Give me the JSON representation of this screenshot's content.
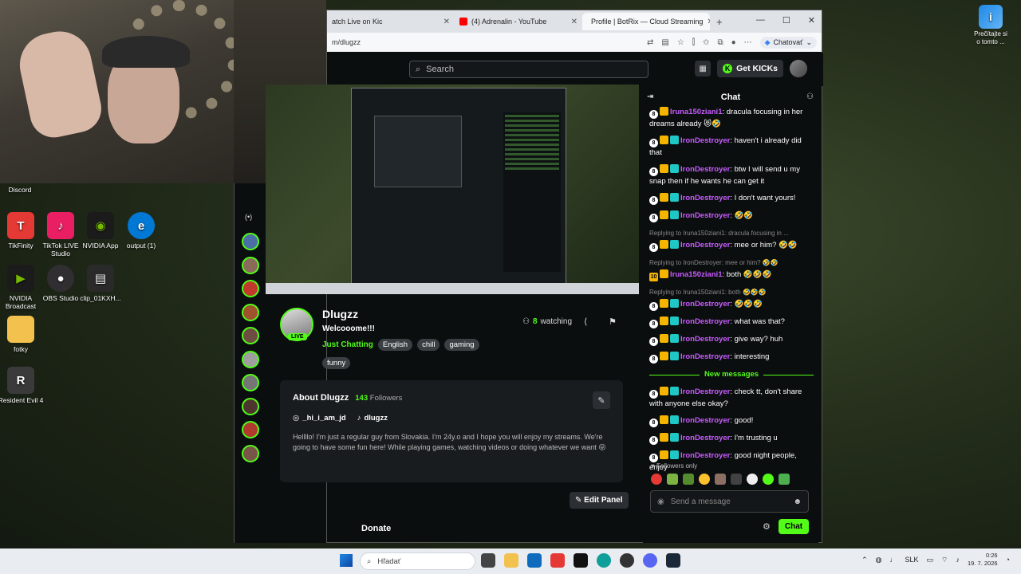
{
  "desktop": {
    "icons": [
      {
        "label": "Discord"
      },
      {
        "label": "TikFinity"
      },
      {
        "label": "TikTok LIVE Studio"
      },
      {
        "label": "NVIDIA App"
      },
      {
        "label": "output (1)"
      },
      {
        "label": "NVIDIA Broadcast"
      },
      {
        "label": "OBS Studio"
      },
      {
        "label": "clip_01KXH..."
      },
      {
        "label": "fotky"
      },
      {
        "label": "Resident Evil 4"
      }
    ],
    "right_icon": {
      "label": "Prečítajte si o tomto ..."
    }
  },
  "browser": {
    "tabs": [
      {
        "label": "atch Live on Kic"
      },
      {
        "label": "(4) Adrenalin - YouTube"
      },
      {
        "label": "Profile | BotRix — Cloud Streaming"
      }
    ],
    "url": "m/dlugzz",
    "chatovat": "Chatovať"
  },
  "kick": {
    "search_placeholder": "Search",
    "get_kicks": "Get KICKs",
    "streamer": {
      "name": "Dlugzz",
      "live": "LIVE",
      "title": "Welcooome!!!",
      "category": "Just Chatting",
      "tags": [
        "English",
        "chill",
        "gaming",
        "funny"
      ],
      "watching_count": "8",
      "watching_label": "watching"
    },
    "about": {
      "title": "About Dlugzz",
      "followers_count": "143",
      "followers_label": "Followers",
      "instagram": "_hi_i_am_jd",
      "tiktok": "dlugzz",
      "bio": "Hellllo! I'm just a regular guy from Slovakia. I'm 24y.o and I hope you will enjoy my streams. We're going to have some fun here! While playing games, watching videos or doing whatever we want 😝"
    },
    "edit_panel": "Edit Panel",
    "donate": "Donate"
  },
  "chat": {
    "title": "Chat",
    "messages": [
      {
        "user": "Iruna150ziani1",
        "text": "dracula focusing in her dreams already 😻🤣"
      },
      {
        "user": "IronDestroyer",
        "text": "haven't i already did that"
      },
      {
        "user": "IronDestroyer",
        "text": "btw I will send u my snap then if he wants he can get it"
      },
      {
        "user": "IronDestroyer",
        "text": "I don't want yours!"
      },
      {
        "user": "IronDestroyer",
        "text": "🤣🤣"
      },
      {
        "reply": "Replying to Iruna150ziani1: dracula focusing in ...",
        "user": "IronDestroyer",
        "text": "mee or him? 🤣🤣"
      },
      {
        "reply": "Replying to IronDestroyer: mee or him? 🤣🤣",
        "user": "Iruna150ziani1",
        "text": "both 🤣🤣🤣"
      },
      {
        "reply": "Replying to Iruna150ziani1: both 🤣🤣🤣",
        "user": "IronDestroyer",
        "text": "🤣🤣🤣"
      },
      {
        "user": "IronDestroyer",
        "text": "what was that?"
      },
      {
        "user": "IronDestroyer",
        "text": "give way? huh"
      },
      {
        "user": "IronDestroyer",
        "text": "interesting"
      }
    ],
    "new_messages_label": "New messages",
    "new_messages": [
      {
        "user": "IronDestroyer",
        "text": "check tt, don't share with anyone else okay?"
      },
      {
        "user": "IronDestroyer",
        "text": "good!"
      },
      {
        "user": "IronDestroyer",
        "text": "I'm trusting u"
      },
      {
        "user": "IronDestroyer",
        "text": "good night people, enjoy"
      }
    ],
    "followers_only": "Followers only",
    "input_placeholder": "Send a message",
    "send_label": "Chat",
    "badge_ten": "10",
    "badge_one": "8"
  },
  "taskbar": {
    "search_placeholder": "Hľadať",
    "lang": "SLK",
    "time": "0:26",
    "date": "19. 7. 2026"
  }
}
